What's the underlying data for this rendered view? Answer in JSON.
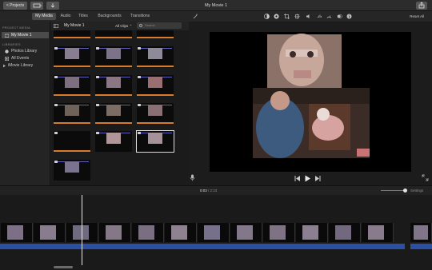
{
  "window": {
    "projects_button": "< Projects",
    "title": "My Movie 1"
  },
  "tabs": [
    {
      "label": "My Media",
      "active": true
    },
    {
      "label": "Audio",
      "active": false
    },
    {
      "label": "Titles",
      "active": false
    },
    {
      "label": "Backgrounds",
      "active": false
    },
    {
      "label": "Transitions",
      "active": false
    }
  ],
  "sidebar": {
    "project_media_heading": "PROJECT MEDIA",
    "project_item": "My Movie 1",
    "libraries_heading": "LIBRARIES",
    "library_items": [
      "Photos Library",
      "All Events",
      "iMovie Library"
    ]
  },
  "browser": {
    "title": "My Movie 1",
    "clips_filter": "All Clips",
    "search_placeholder": "Search"
  },
  "viewer": {
    "reset_all": "Reset All",
    "toolbar_icons": [
      "magic-wand-icon",
      "color-balance-icon",
      "color-correction-icon",
      "crop-icon",
      "stabilization-icon",
      "volume-icon",
      "noise-reduction-icon",
      "speed-icon",
      "filter-icon",
      "info-icon"
    ]
  },
  "timeline": {
    "current_time": "0:03",
    "separator": " / ",
    "total_time": "2:23",
    "settings": "Settings",
    "clip_count": 13
  },
  "colors": {
    "accent_orange": "#d77b2e",
    "audio_blue": "#2b4fa3",
    "selected_tab": "#4a4a4a"
  }
}
